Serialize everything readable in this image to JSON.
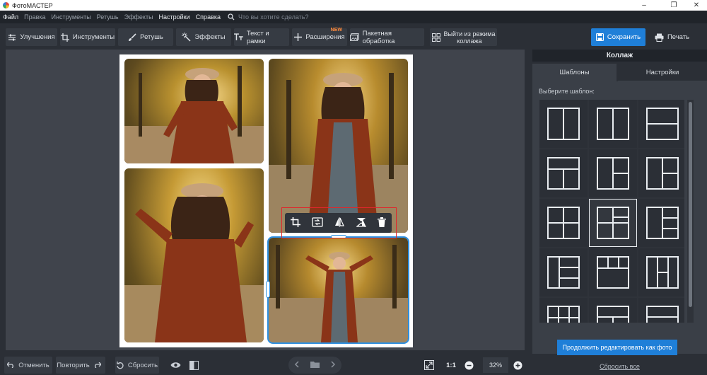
{
  "window": {
    "title": "ФотоМАСТЕР"
  },
  "menu": {
    "items": [
      "Файл",
      "Правка",
      "Инструменты",
      "Ретушь",
      "Эффекты",
      "Настройки",
      "Справка"
    ],
    "search_placeholder": "Что вы хотите сделать?"
  },
  "toolbar": {
    "improve": "Улучшения",
    "tools": "Инструменты",
    "retouch": "Ретушь",
    "effects": "Эффекты",
    "text": "Текст и рамки",
    "extensions": "Расширения",
    "new_badge": "NEW",
    "batch": "Пакетная обработка",
    "exit_collage_1": "Выйти из режима",
    "exit_collage_2": "коллажа",
    "save": "Сохранить",
    "print": "Печать"
  },
  "bottom": {
    "undo": "Отменить",
    "redo": "Повторить",
    "reset": "Сбросить",
    "ratio": "1:1",
    "zoom": "32%"
  },
  "panel": {
    "title": "Коллаж",
    "tabs": [
      "Шаблоны",
      "Настройки"
    ],
    "choose_label": "Выберите шаблон:",
    "selected_template": 7,
    "continue": "Продолжить редактировать как фото",
    "reset_all": "Сбросить все"
  },
  "colors": {
    "accent": "#1f7fd8",
    "highlight": "#e0262b",
    "selection": "#2d8fe0"
  }
}
